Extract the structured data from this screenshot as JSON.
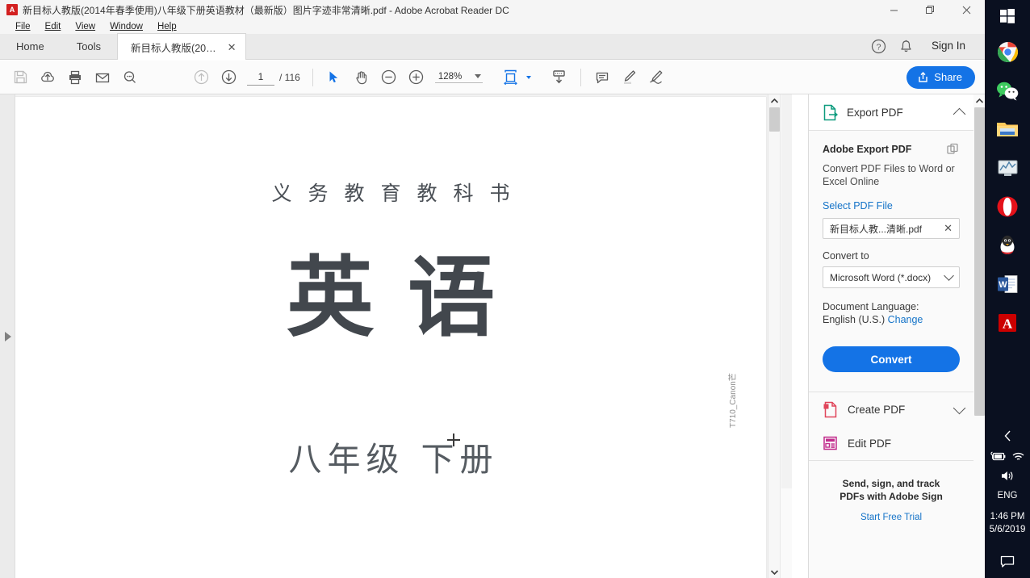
{
  "window": {
    "title": "新目标人教版(2014年春季使用)八年级下册英语教材（最新版）图片字迹非常清晰.pdf - Adobe Acrobat Reader DC",
    "app_icon": "A",
    "minimize_label": "Minimize",
    "maximize_label": "Restore",
    "close_label": "Close"
  },
  "menubar": {
    "items": [
      {
        "label": "File"
      },
      {
        "label": "Edit"
      },
      {
        "label": "View"
      },
      {
        "label": "Window"
      },
      {
        "label": "Help"
      }
    ]
  },
  "tabbar": {
    "home": "Home",
    "tools": "Tools",
    "document_tab": "新目标人教版(2014...",
    "close_glyph": "✕",
    "help_icon": "help-circle-icon",
    "bell_icon": "bell-icon",
    "sign_in": "Sign In"
  },
  "toolbar": {
    "save_label": "Save",
    "upload_label": "Save to cloud",
    "print_label": "Print",
    "email_label": "Email",
    "search_label": "Find",
    "prev_page_label": "Previous Page",
    "next_page_label": "Next Page",
    "page_current": "1",
    "page_total": "/ 116",
    "select_tool_label": "Select",
    "hand_tool_label": "Hand Tool",
    "zoom_out_label": "Zoom Out",
    "zoom_in_label": "Zoom In",
    "zoom_value": "128%",
    "fit_label": "Fit Page",
    "scroll_label": "Scrolling Mode",
    "comment_label": "Comment",
    "highlight_label": "Highlight",
    "sign_label": "Fill & Sign",
    "share_label": "Share",
    "accent_color": "#1473e6"
  },
  "document": {
    "line1": "义务教育教科书",
    "title": "英语",
    "grade": "八年级 下册",
    "vertical_note": "T710_Canon芒"
  },
  "tools_panel": {
    "export": {
      "header": "Export PDF",
      "heading": "Adobe Export PDF",
      "description": "Convert PDF Files to Word or Excel Online",
      "select_link": "Select PDF File",
      "file_name": "新目标人教...清晰.pdf",
      "file_remove": "✕",
      "convert_to_label": "Convert to",
      "convert_to_value": "Microsoft Word (*.docx)",
      "doc_lang_label": "Document Language:",
      "doc_lang_value": "English (U.S.)",
      "doc_lang_change": "Change",
      "convert_button": "Convert"
    },
    "create_pdf": "Create PDF",
    "edit_pdf": "Edit PDF",
    "promo_line1": "Send, sign, and track",
    "promo_line2": "PDFs with Adobe Sign",
    "promo_link": "Start Free Trial"
  },
  "taskbar": {
    "items": [
      {
        "name": "start-button",
        "label": "Start"
      },
      {
        "name": "chrome-icon",
        "label": "Google Chrome"
      },
      {
        "name": "wechat-icon",
        "label": "WeChat"
      },
      {
        "name": "file-explorer-icon",
        "label": "File Explorer"
      },
      {
        "name": "media-icon",
        "label": "Media Player"
      },
      {
        "name": "opera-icon",
        "label": "Opera"
      },
      {
        "name": "qq-icon",
        "label": "QQ"
      },
      {
        "name": "word-icon",
        "label": "Microsoft Word"
      },
      {
        "name": "acrobat-icon",
        "label": "Adobe Acrobat Reader DC"
      }
    ],
    "tray": {
      "expand": "‹",
      "battery": "battery-icon",
      "wifi": "wifi-icon",
      "volume": "volume-icon",
      "language": "ENG",
      "time": "1:46 PM",
      "date": "5/6/2019",
      "notifications": "notification-icon"
    }
  }
}
